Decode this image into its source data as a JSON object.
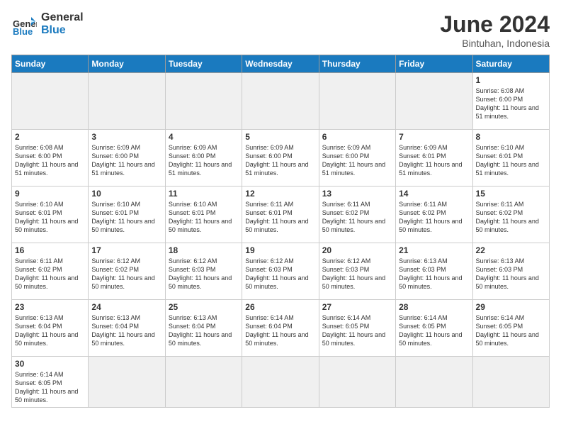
{
  "header": {
    "logo_text_1": "General",
    "logo_text_2": "Blue",
    "month": "June 2024",
    "location": "Bintuhan, Indonesia"
  },
  "days_of_week": [
    "Sunday",
    "Monday",
    "Tuesday",
    "Wednesday",
    "Thursday",
    "Friday",
    "Saturday"
  ],
  "weeks": [
    [
      {
        "day": "",
        "empty": true
      },
      {
        "day": "",
        "empty": true
      },
      {
        "day": "",
        "empty": true
      },
      {
        "day": "",
        "empty": true
      },
      {
        "day": "",
        "empty": true
      },
      {
        "day": "",
        "empty": true
      },
      {
        "day": "1",
        "sunrise": "6:08 AM",
        "sunset": "6:00 PM",
        "daylight": "11 hours and 51 minutes."
      }
    ],
    [
      {
        "day": "2",
        "sunrise": "6:08 AM",
        "sunset": "6:00 PM",
        "daylight": "11 hours and 51 minutes."
      },
      {
        "day": "3",
        "sunrise": "6:09 AM",
        "sunset": "6:00 PM",
        "daylight": "11 hours and 51 minutes."
      },
      {
        "day": "4",
        "sunrise": "6:09 AM",
        "sunset": "6:00 PM",
        "daylight": "11 hours and 51 minutes."
      },
      {
        "day": "5",
        "sunrise": "6:09 AM",
        "sunset": "6:00 PM",
        "daylight": "11 hours and 51 minutes."
      },
      {
        "day": "6",
        "sunrise": "6:09 AM",
        "sunset": "6:00 PM",
        "daylight": "11 hours and 51 minutes."
      },
      {
        "day": "7",
        "sunrise": "6:09 AM",
        "sunset": "6:01 PM",
        "daylight": "11 hours and 51 minutes."
      },
      {
        "day": "8",
        "sunrise": "6:10 AM",
        "sunset": "6:01 PM",
        "daylight": "11 hours and 51 minutes."
      }
    ],
    [
      {
        "day": "9",
        "sunrise": "6:10 AM",
        "sunset": "6:01 PM",
        "daylight": "11 hours and 50 minutes."
      },
      {
        "day": "10",
        "sunrise": "6:10 AM",
        "sunset": "6:01 PM",
        "daylight": "11 hours and 50 minutes."
      },
      {
        "day": "11",
        "sunrise": "6:10 AM",
        "sunset": "6:01 PM",
        "daylight": "11 hours and 50 minutes."
      },
      {
        "day": "12",
        "sunrise": "6:11 AM",
        "sunset": "6:01 PM",
        "daylight": "11 hours and 50 minutes."
      },
      {
        "day": "13",
        "sunrise": "6:11 AM",
        "sunset": "6:02 PM",
        "daylight": "11 hours and 50 minutes."
      },
      {
        "day": "14",
        "sunrise": "6:11 AM",
        "sunset": "6:02 PM",
        "daylight": "11 hours and 50 minutes."
      },
      {
        "day": "15",
        "sunrise": "6:11 AM",
        "sunset": "6:02 PM",
        "daylight": "11 hours and 50 minutes."
      }
    ],
    [
      {
        "day": "16",
        "sunrise": "6:11 AM",
        "sunset": "6:02 PM",
        "daylight": "11 hours and 50 minutes."
      },
      {
        "day": "17",
        "sunrise": "6:12 AM",
        "sunset": "6:02 PM",
        "daylight": "11 hours and 50 minutes."
      },
      {
        "day": "18",
        "sunrise": "6:12 AM",
        "sunset": "6:03 PM",
        "daylight": "11 hours and 50 minutes."
      },
      {
        "day": "19",
        "sunrise": "6:12 AM",
        "sunset": "6:03 PM",
        "daylight": "11 hours and 50 minutes."
      },
      {
        "day": "20",
        "sunrise": "6:12 AM",
        "sunset": "6:03 PM",
        "daylight": "11 hours and 50 minutes."
      },
      {
        "day": "21",
        "sunrise": "6:13 AM",
        "sunset": "6:03 PM",
        "daylight": "11 hours and 50 minutes."
      },
      {
        "day": "22",
        "sunrise": "6:13 AM",
        "sunset": "6:03 PM",
        "daylight": "11 hours and 50 minutes."
      }
    ],
    [
      {
        "day": "23",
        "sunrise": "6:13 AM",
        "sunset": "6:04 PM",
        "daylight": "11 hours and 50 minutes."
      },
      {
        "day": "24",
        "sunrise": "6:13 AM",
        "sunset": "6:04 PM",
        "daylight": "11 hours and 50 minutes."
      },
      {
        "day": "25",
        "sunrise": "6:13 AM",
        "sunset": "6:04 PM",
        "daylight": "11 hours and 50 minutes."
      },
      {
        "day": "26",
        "sunrise": "6:14 AM",
        "sunset": "6:04 PM",
        "daylight": "11 hours and 50 minutes."
      },
      {
        "day": "27",
        "sunrise": "6:14 AM",
        "sunset": "6:05 PM",
        "daylight": "11 hours and 50 minutes."
      },
      {
        "day": "28",
        "sunrise": "6:14 AM",
        "sunset": "6:05 PM",
        "daylight": "11 hours and 50 minutes."
      },
      {
        "day": "29",
        "sunrise": "6:14 AM",
        "sunset": "6:05 PM",
        "daylight": "11 hours and 50 minutes."
      }
    ],
    [
      {
        "day": "30",
        "sunrise": "6:14 AM",
        "sunset": "6:05 PM",
        "daylight": "11 hours and 50 minutes."
      },
      {
        "day": "",
        "empty": true
      },
      {
        "day": "",
        "empty": true
      },
      {
        "day": "",
        "empty": true
      },
      {
        "day": "",
        "empty": true
      },
      {
        "day": "",
        "empty": true
      },
      {
        "day": "",
        "empty": true
      }
    ]
  ]
}
